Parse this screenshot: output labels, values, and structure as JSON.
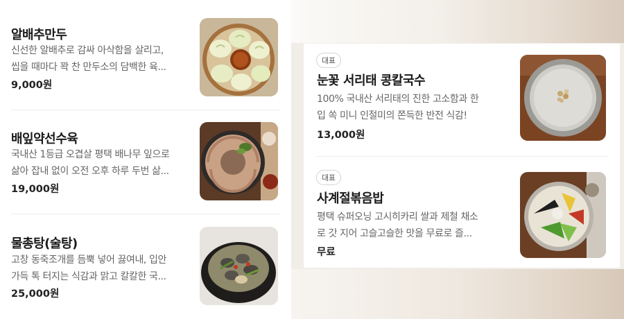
{
  "menu_left": [
    {
      "title": "알배추만두",
      "desc_line1": "신선한 알배추로 감싸 아삭함을 살리고,",
      "desc_line2": "씹을 때마다 꽉 찬 만두소의 담백한 육...",
      "price": "9,000원",
      "image_icon": "steamed-dumplings-image"
    },
    {
      "title": "배잎약선수육",
      "desc_line1": "국내산 1등급 오겹살 평택 배나무 잎으로",
      "desc_line2": "삶아 잡내 없이 오전 오후 하루 두번 삶...",
      "price": "19,000원",
      "image_icon": "boiled-pork-image"
    },
    {
      "title": "물총탕(술탕)",
      "desc_line1": "고창 동죽조개를 듬뿍 넣어 끓여내, 입안",
      "desc_line2": "가득 톡 터지는 식감과 맑고 칼칼한 국...",
      "price": "25,000원",
      "image_icon": "clam-soup-image"
    }
  ],
  "menu_right": [
    {
      "badge": "대표",
      "title": "눈꽃 서리태 콩칼국수",
      "desc_line1": "100% 국내산 서리태의 진한 고소함과 한",
      "desc_line2": "입 쏙 미니 인절미의 쫀득한 반전 식감!",
      "price": "13,000원",
      "image_icon": "soybean-noodle-image"
    },
    {
      "badge": "대표",
      "title": "사계절볶음밥",
      "desc_line1": "평택 슈퍼오닝 고시히카리 쌀과 제철 채소",
      "desc_line2": "로 갓 지어 고슬고슬한 맛을 무료로 즐...",
      "price": "무료",
      "image_icon": "fried-rice-image"
    }
  ]
}
